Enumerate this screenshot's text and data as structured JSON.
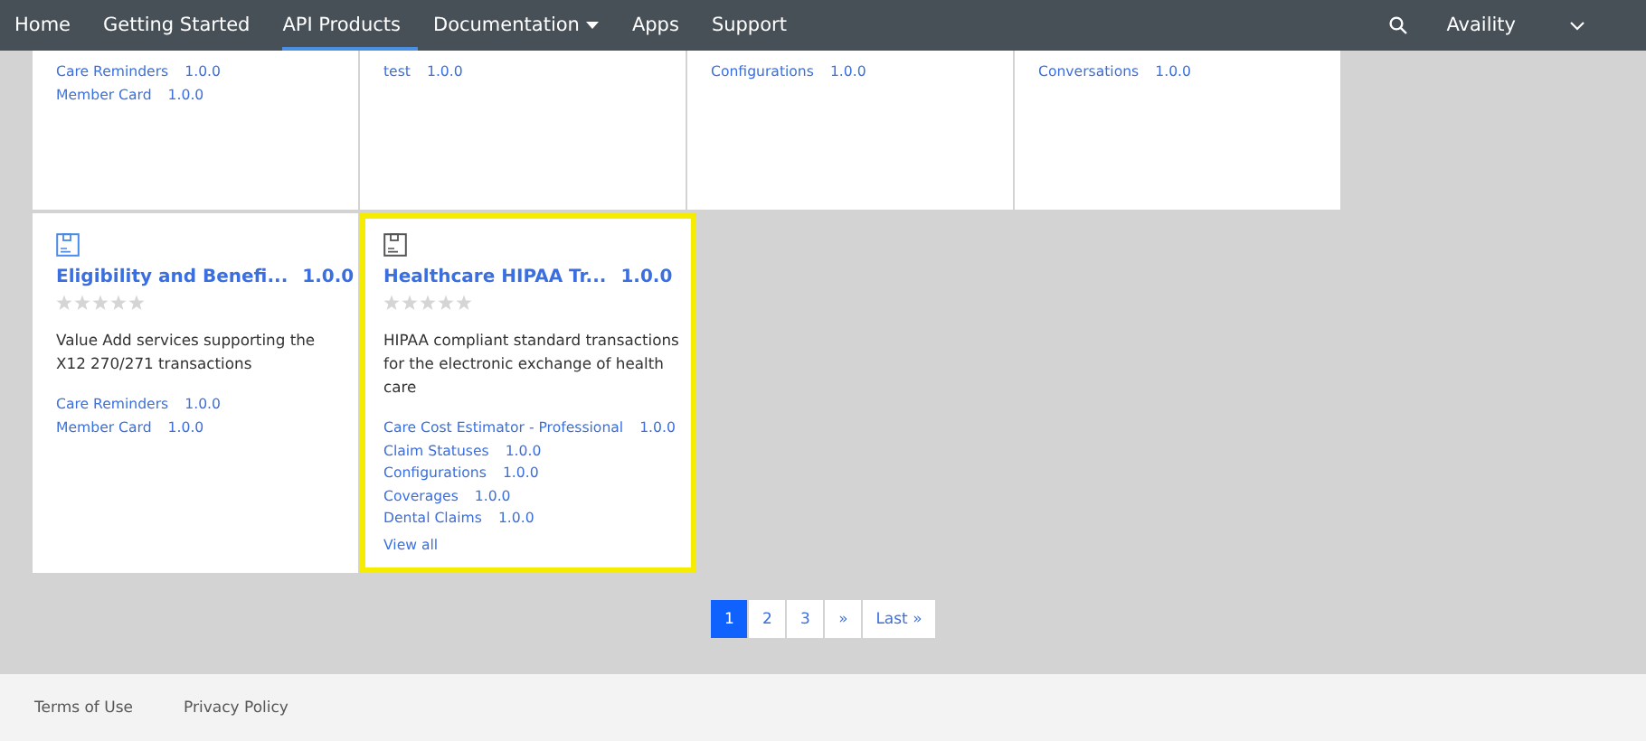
{
  "navbar": {
    "items": [
      {
        "label": "Home",
        "selected": false,
        "has_menu": false
      },
      {
        "label": "Getting Started",
        "selected": false,
        "has_menu": false
      },
      {
        "label": "API Products",
        "selected": true,
        "has_menu": false
      },
      {
        "label": "Documentation",
        "selected": false,
        "has_menu": true
      },
      {
        "label": "Apps",
        "selected": false,
        "has_menu": false
      },
      {
        "label": "Support",
        "selected": false,
        "has_menu": false
      }
    ],
    "account": "Availity"
  },
  "top_cards": [
    {
      "apis": [
        {
          "name": "Care Reminders",
          "version": "1.0.0"
        },
        {
          "name": "Member Card",
          "version": "1.0.0"
        }
      ]
    },
    {
      "apis": [
        {
          "name": "test",
          "version": "1.0.0"
        }
      ]
    },
    {
      "apis": [
        {
          "name": "Configurations",
          "version": "1.0.0"
        }
      ]
    },
    {
      "apis": [
        {
          "name": "Conversations",
          "version": "1.0.0"
        }
      ]
    }
  ],
  "cards": [
    {
      "title": "Eligibility and Benefi...",
      "version": "1.0.0",
      "stars": 0,
      "highlighted": false,
      "description": "Value Add services supporting the X12 270/271 transactions",
      "apis": [
        {
          "name": "Care Reminders",
          "version": "1.0.0"
        },
        {
          "name": "Member Card",
          "version": "1.0.0"
        }
      ]
    },
    {
      "title": "Healthcare HIPAA Tr...",
      "version": "1.0.0",
      "stars": 0,
      "highlighted": true,
      "description": "HIPAA compliant standard transactions for the electronic exchange of health care",
      "apis": [
        {
          "name": "Care Cost Estimator - Professional",
          "version": "1.0.0"
        },
        {
          "name": "Claim Statuses",
          "version": "1.0.0"
        },
        {
          "name": "Configurations",
          "version": "1.0.0"
        },
        {
          "name": "Coverages",
          "version": "1.0.0"
        },
        {
          "name": "Dental Claims",
          "version": "1.0.0"
        }
      ],
      "view_all": "View all"
    }
  ],
  "pagination": [
    {
      "label": "1",
      "selected": true
    },
    {
      "label": "2",
      "selected": false
    },
    {
      "label": "3",
      "selected": false
    },
    {
      "label": "»",
      "selected": false
    },
    {
      "label": "Last »",
      "selected": false
    }
  ],
  "footer": {
    "links": [
      "Terms of Use",
      "Privacy Policy"
    ]
  }
}
